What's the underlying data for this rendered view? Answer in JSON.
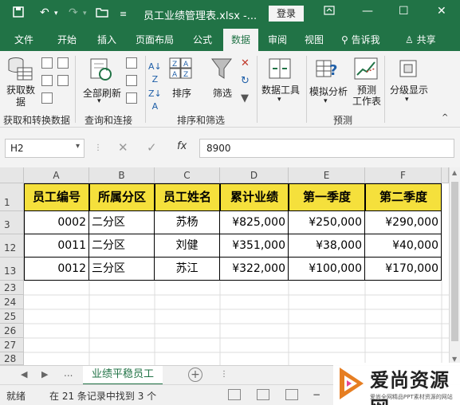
{
  "titlebar": {
    "title": "员工业绩管理表.xlsx  -...",
    "login": "登录"
  },
  "tabs": [
    {
      "label": "文件"
    },
    {
      "label": "开始"
    },
    {
      "label": "插入"
    },
    {
      "label": "页面布局"
    },
    {
      "label": "公式"
    },
    {
      "label": "数据"
    },
    {
      "label": "审阅"
    },
    {
      "label": "视图"
    }
  ],
  "tell_me": "告诉我",
  "share": "共享",
  "ribbon": {
    "get_data": "获取数\n据",
    "refresh_all": "全部刷新",
    "sort": "排序",
    "filter": "筛选",
    "data_tools": "数据工具",
    "what_if": "模拟分析",
    "forecast_sheet": "预测\n工作表",
    "outline": "分级显示",
    "group_get_transform": "获取和转换数据",
    "group_queries": "查询和连接",
    "group_sort_filter": "排序和筛选",
    "group_forecast": "预测"
  },
  "formula_bar": {
    "name_box": "H2",
    "fx": "fx",
    "value": "8900"
  },
  "columns": [
    "A",
    "B",
    "C",
    "D",
    "E",
    "F"
  ],
  "rows": [
    {
      "num": "1",
      "cells": [
        "员工编号",
        "所属分区",
        "员工姓名",
        "累计业绩",
        "第一季度",
        "第二季度"
      ]
    },
    {
      "num": "3",
      "cells": [
        "0002",
        "二分区",
        "苏杨",
        "¥825,000",
        "¥250,000",
        "¥290,000"
      ]
    },
    {
      "num": "12",
      "cells": [
        "0011",
        "二分区",
        "刘健",
        "¥351,000",
        "¥38,000",
        "¥40,000"
      ]
    },
    {
      "num": "13",
      "cells": [
        "0012",
        "三分区",
        "苏江",
        "¥322,000",
        "¥100,000",
        "¥170,000"
      ]
    },
    {
      "num": "23",
      "cells": []
    },
    {
      "num": "24",
      "cells": []
    },
    {
      "num": "25",
      "cells": []
    },
    {
      "num": "26",
      "cells": []
    },
    {
      "num": "27",
      "cells": []
    },
    {
      "num": "28",
      "cells": []
    }
  ],
  "sheet": {
    "more": "...",
    "active_tab": "业绩平稳员工"
  },
  "status": {
    "ready": "就绪",
    "records": "在 21 条记录中找到 3 个"
  },
  "watermark": {
    "title": "爱尚资源网",
    "subtitle": "爱尚全网精品PPT素材资源的网站"
  }
}
